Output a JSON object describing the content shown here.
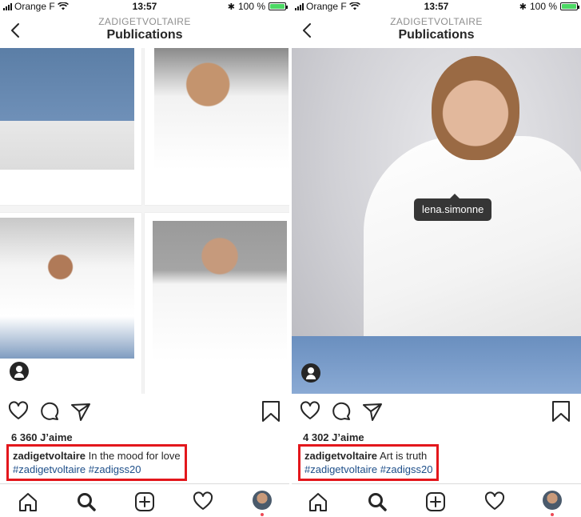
{
  "status": {
    "carrier": "Orange F",
    "time": "13:57",
    "battery": "100 %",
    "battery_level": 1.0
  },
  "header": {
    "account": "ZADIGETVOLTAIRE",
    "title": "Publications"
  },
  "left_post": {
    "likes": "6 360 J’aime",
    "username": "zadigetvoltaire",
    "caption": "In the mood for love",
    "hashtag1": "#zadigetvoltaire",
    "hashtag2": "#zadigss20"
  },
  "right_post": {
    "likes": "4 302 J’aime",
    "username": "zadigetvoltaire",
    "caption": "Art is truth",
    "hashtag1": "#zadigetvoltaire",
    "hashtag2": "#zadigss20",
    "tag": "lena.simonne"
  },
  "icons": {
    "back": "chevron-left-icon",
    "like": "heart-icon",
    "comment": "comment-bubble-icon",
    "share": "paper-plane-icon",
    "save": "bookmark-icon",
    "home": "home-icon",
    "search": "search-icon",
    "add": "plus-square-icon",
    "activity": "heart-icon",
    "profile": "avatar"
  },
  "colors": {
    "highlight_border": "#e3171c",
    "hashtag": "#1d4e89",
    "notification_dot": "#ed4956"
  }
}
